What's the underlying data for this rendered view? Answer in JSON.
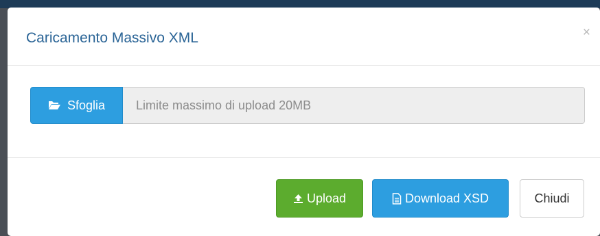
{
  "modal": {
    "title": "Caricamento Massivo XML",
    "close_symbol": "×"
  },
  "file_input": {
    "browse_label": "Sfoglia",
    "browse_icon": "folder-open-icon",
    "placeholder": "Limite massimo di upload 20MB"
  },
  "footer": {
    "upload_label": "Upload",
    "upload_icon": "upload-icon",
    "download_label": "Download XSD",
    "download_icon": "file-text-icon",
    "close_label": "Chiudi"
  },
  "colors": {
    "title": "#2a6496",
    "primary_blue": "#2d9ee0",
    "success_green": "#5cac2e",
    "input_bg": "#eeeeee"
  }
}
